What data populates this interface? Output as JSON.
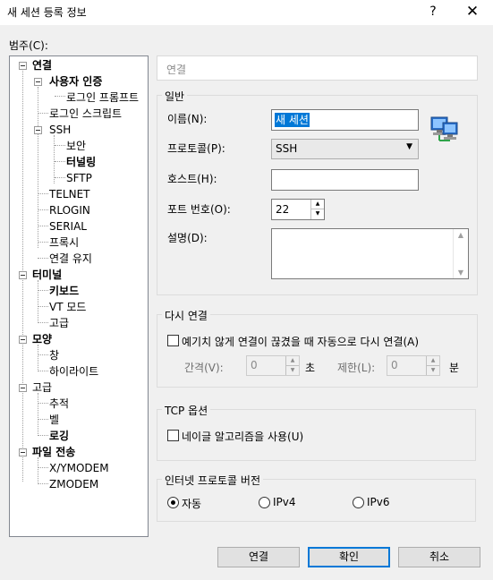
{
  "window": {
    "title": "새 세션 등록 정보",
    "help": "?",
    "close": "✕"
  },
  "category_label": "범주(C):",
  "tree": [
    {
      "label": "연결",
      "bold": true
    },
    {
      "label": "사용자 인증",
      "bold": true
    },
    {
      "label": "로그인 프롬프트",
      "bold": false
    },
    {
      "label": "로그인 스크립트",
      "bold": false
    },
    {
      "label": "SSH",
      "bold": false
    },
    {
      "label": "보안",
      "bold": false
    },
    {
      "label": "터널링",
      "bold": true
    },
    {
      "label": "SFTP",
      "bold": false
    },
    {
      "label": "TELNET",
      "bold": false
    },
    {
      "label": "RLOGIN",
      "bold": false
    },
    {
      "label": "SERIAL",
      "bold": false
    },
    {
      "label": "프록시",
      "bold": false
    },
    {
      "label": "연결 유지",
      "bold": false
    },
    {
      "label": "터미널",
      "bold": true
    },
    {
      "label": "키보드",
      "bold": true
    },
    {
      "label": "VT 모드",
      "bold": false
    },
    {
      "label": "고급",
      "bold": false
    },
    {
      "label": "모양",
      "bold": true
    },
    {
      "label": "창",
      "bold": false
    },
    {
      "label": "하이라이트",
      "bold": false
    },
    {
      "label": "고급",
      "bold": false
    },
    {
      "label": "추적",
      "bold": false
    },
    {
      "label": "벨",
      "bold": false
    },
    {
      "label": "로깅",
      "bold": true
    },
    {
      "label": "파일 전송",
      "bold": true
    },
    {
      "label": "X/YMODEM",
      "bold": false
    },
    {
      "label": "ZMODEM",
      "bold": false
    }
  ],
  "header": "연결",
  "general": {
    "title": "일반",
    "name_label": "이름(N):",
    "name_value": "새 세션",
    "protocol_label": "프로토콜(P):",
    "protocol_value": "SSH",
    "host_label": "호스트(H):",
    "host_value": "",
    "port_label": "포트 번호(O):",
    "port_value": "22",
    "desc_label": "설명(D):",
    "desc_value": ""
  },
  "reconnect": {
    "title": "다시 연결",
    "checkbox_label": "예기치 않게 연결이 끊겼을 때 자동으로 다시 연결(A)",
    "interval_label": "간격(V):",
    "interval_value": "0",
    "interval_unit": "초",
    "limit_label": "제한(L):",
    "limit_value": "0",
    "limit_unit": "분"
  },
  "tcp": {
    "title": "TCP 옵션",
    "nagle_label": "네이글 알고리즘을 사용(U)"
  },
  "ipver": {
    "title": "인터넷 프로토콜 버전",
    "options": [
      "자동",
      "IPv4",
      "IPv6"
    ],
    "selected": "자동"
  },
  "buttons": {
    "connect": "연결",
    "ok": "확인",
    "cancel": "취소"
  },
  "colors": {
    "accent": "#0078d7",
    "background": "#f0f0f0"
  }
}
